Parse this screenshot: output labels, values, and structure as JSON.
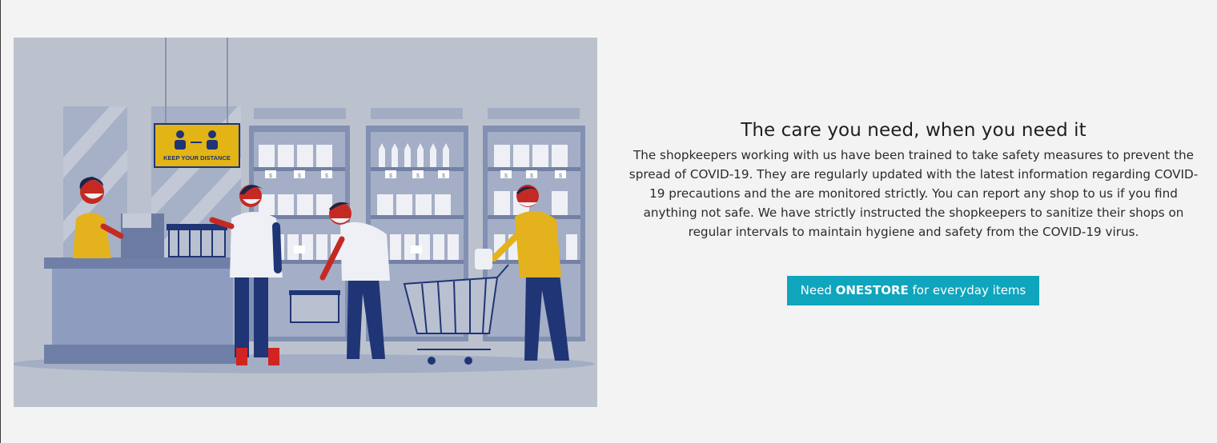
{
  "section": {
    "heading": "The care you need, when you need it",
    "paragraph": "The shopkeepers working with us have been trained to take safety measures to prevent the spread of COVID-19. They are regularly updated with the latest information regarding COVID-19 precautions and the are monitored strictly. You can report any shop to us if you find anything not safe. We have strictly instructed the shopkeepers to sanitize their shops on regular intervals to maintain hygiene and safety from the COVID-19 virus.",
    "cta": {
      "prefix": "Need ",
      "brand": "ONESTORE",
      "suffix": " for everyday items"
    }
  },
  "illustration": {
    "sign_text": "KEEP YOUR DISTANCE",
    "price_tag": "$"
  },
  "colors": {
    "page_background": "#f3f3f3",
    "illustration_background": "#bcc2cd",
    "button_background": "#0ea5bd",
    "button_text": "#ffffff",
    "sign_yellow": "#e3b415",
    "shirt_yellow": "#e3b21d",
    "pants_navy": "#1f3575",
    "mask_red": "#d1231f"
  }
}
